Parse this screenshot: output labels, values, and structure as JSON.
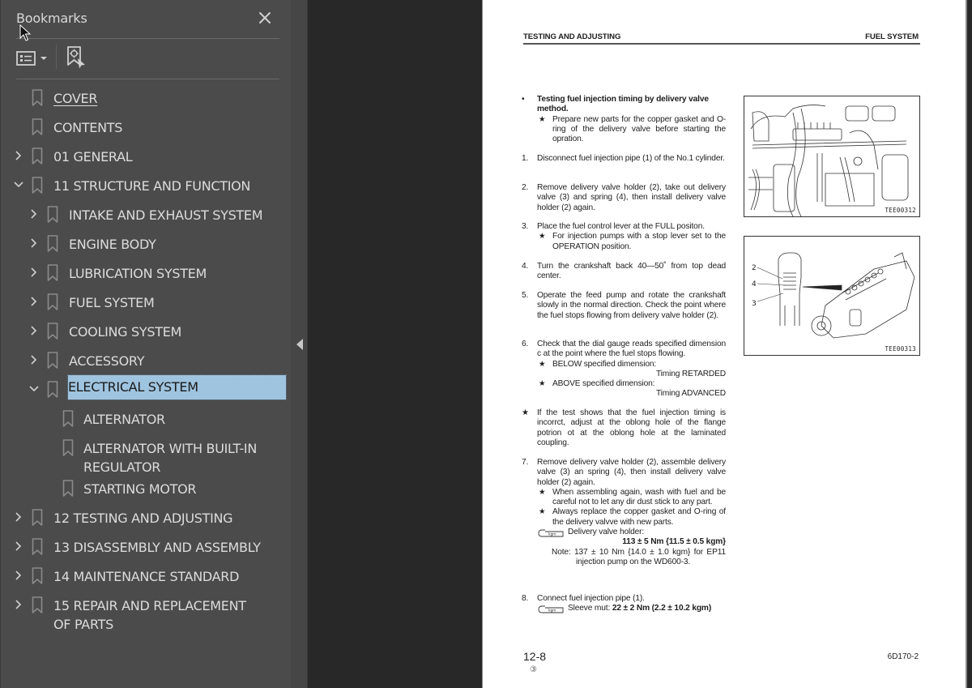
{
  "sidebar": {
    "title": "Bookmarks",
    "close_icon": "close-icon",
    "toolbar": {
      "options_icon": "list-options-icon",
      "find_icon": "find-current-bookmark-icon"
    },
    "items": [
      {
        "label": "COVER",
        "level": 0,
        "expander": "none",
        "underlined": true
      },
      {
        "label": "CONTENTS",
        "level": 0,
        "expander": "none"
      },
      {
        "label": "01 GENERAL",
        "level": 0,
        "expander": "collapsed"
      },
      {
        "label": "11 STRUCTURE AND FUNCTION",
        "level": 0,
        "expander": "expanded"
      },
      {
        "label": "INTAKE AND EXHAUST SYSTEM",
        "level": 1,
        "expander": "collapsed"
      },
      {
        "label": "ENGINE BODY",
        "level": 1,
        "expander": "collapsed"
      },
      {
        "label": "LUBRICATION SYSTEM",
        "level": 1,
        "expander": "collapsed"
      },
      {
        "label": "FUEL SYSTEM",
        "level": 1,
        "expander": "collapsed"
      },
      {
        "label": "COOLING SYSTEM",
        "level": 1,
        "expander": "collapsed"
      },
      {
        "label": "ACCESSORY",
        "level": 1,
        "expander": "collapsed"
      },
      {
        "label": "ELECTRICAL SYSTEM",
        "level": 1,
        "expander": "expanded",
        "selected": true
      },
      {
        "label": "ALTERNATOR",
        "level": 2,
        "expander": "none"
      },
      {
        "label": "ALTERNATOR WITH BUILT-IN REGULATOR",
        "level": 2,
        "expander": "none"
      },
      {
        "label": "STARTING MOTOR",
        "level": 2,
        "expander": "none"
      },
      {
        "label": "12 TESTING AND ADJUSTING",
        "level": 0,
        "expander": "collapsed"
      },
      {
        "label": "13 DISASSEMBLY AND ASSEMBLY",
        "level": 0,
        "expander": "collapsed"
      },
      {
        "label": "14 MAINTENANCE STANDARD",
        "level": 0,
        "expander": "collapsed"
      },
      {
        "label": "15 REPAIR AND REPLACEMENT OF PARTS",
        "level": 0,
        "expander": "collapsed"
      }
    ]
  },
  "colors": {
    "sidebar_bg": "#4b4b4b",
    "viewer_bg": "#282828",
    "selection": "#9fc4e0",
    "text": "#dcdcdc"
  },
  "page": {
    "header_left": "TESTING AND ADJUSTING",
    "header_right": "FUEL SYSTEM",
    "intro": {
      "bullet": "•",
      "title": "Testing fuel injection timing by delivery valve method.",
      "note": "Prepare new parts for the copper gasket and O-ring of the delivery valve before starting the opration."
    },
    "steps": [
      {
        "num": "1.",
        "text": "Disconnect fuel injection pipe (1) of the No.1 cylinder."
      },
      {
        "num": "2.",
        "text": "Remove delivery valve holder (2), take out delivery valve (3) and spring (4), then install delivery valve holder (2) again."
      },
      {
        "num": "3.",
        "text": "Place the fuel control lever at the FULL positon.",
        "note": "For injection pumps with a stop lever set to the OPERATION position."
      },
      {
        "num": "4.",
        "text": "Turn the crankshaft back 40—50˚ from top dead center."
      },
      {
        "num": "5.",
        "text": "Operate the feed pump and rotate the crankshaft slowly in the normal direction. Check the point where the fuel stops flowing from delivery valve holder (2)."
      },
      {
        "num": "6.",
        "text": "Check that the dial gauge reads specified dimension c at the point where the fuel stops flowing.",
        "below_label": "BELOW specified dimension:",
        "below_value": "Timing RETARDED",
        "above_label": "ABOVE specified dimension:",
        "above_value": "Timing ADVANCED"
      },
      {
        "num": "★",
        "text": "If the test shows that the fuel injection timing is incorrct, adjust at the oblong hole of the flange potrion ot at the oblong hole at the laminated coupling."
      },
      {
        "num": "7.",
        "text": "Remove delivery valve holder (2), assemble delivery valve (3) an spring (4), then install delivery valve holder (2) again.",
        "note1": "When assembling again, wash with fuel and be careful not to  let any dir dust stick to any part.",
        "note2": "Always replace the copper gasket and O-ring of the delivery valvve with new parts.",
        "torque_label": "Delivery valve holder:",
        "torque_value": "113 ± 5 Nm {11.5 ± 0.5 kgm}",
        "torque_note": "Note: 137 ± 10 Nm {14.0 ± 1.0 kgm} for EP11 injection pump on the WD600-3."
      },
      {
        "num": "8.",
        "text": "Connect fuel injection pipe (1).",
        "torque_label": "Sleeve mut:",
        "torque_value": "22 ± 2 Nm (2.2 ± 10.2 kgm)"
      }
    ],
    "figures": [
      {
        "code": "TEE00312"
      },
      {
        "code": "TEE00313",
        "callouts": [
          "2",
          "4",
          "3"
        ]
      }
    ],
    "page_number": "12-8",
    "revision_mark": "③",
    "model_code": "6D170-2",
    "wrench_icon_text": "kgm"
  }
}
